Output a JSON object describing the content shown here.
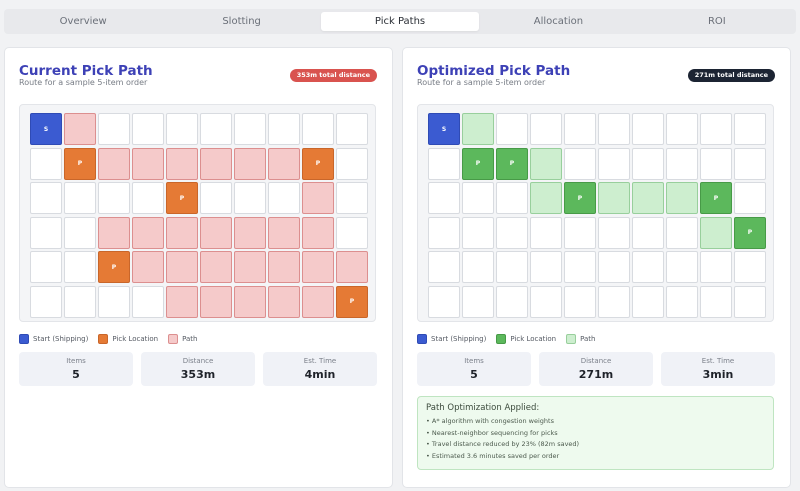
{
  "tabs": [
    "Overview",
    "Slotting",
    "Pick Paths",
    "Allocation",
    "ROI"
  ],
  "active_tab": "Pick Paths",
  "current": {
    "title": "Current Pick Path",
    "subtitle": "Route for a sample 5-item order",
    "badge": "353m total distance",
    "grid": [
      [
        "S",
        "R",
        "E",
        "E",
        "E",
        "E",
        "E",
        "E",
        "E",
        "E"
      ],
      [
        "E",
        "P",
        "R",
        "R",
        "R",
        "R",
        "R",
        "R",
        "P",
        "E"
      ],
      [
        "E",
        "E",
        "E",
        "E",
        "P",
        "E",
        "E",
        "E",
        "R",
        "E"
      ],
      [
        "E",
        "E",
        "R",
        "R",
        "R",
        "R",
        "R",
        "R",
        "R",
        "E"
      ],
      [
        "E",
        "E",
        "P",
        "R",
        "R",
        "R",
        "R",
        "R",
        "R",
        "R"
      ],
      [
        "E",
        "E",
        "E",
        "E",
        "R",
        "R",
        "R",
        "R",
        "R",
        "P"
      ]
    ],
    "legend": {
      "start": "Start (Shipping)",
      "pick": "Pick Location",
      "path": "Path"
    },
    "stats": [
      {
        "label": "Items",
        "value": "5"
      },
      {
        "label": "Distance",
        "value": "353m"
      },
      {
        "label": "Est. Time",
        "value": "4min"
      }
    ]
  },
  "optimized": {
    "title": "Optimized Pick Path",
    "subtitle": "Route for a sample 5-item order",
    "badge": "271m total distance",
    "grid": [
      [
        "S",
        "G",
        "E",
        "E",
        "E",
        "E",
        "E",
        "E",
        "E",
        "E"
      ],
      [
        "E",
        "P",
        "P",
        "G",
        "E",
        "E",
        "E",
        "E",
        "E",
        "E"
      ],
      [
        "E",
        "E",
        "E",
        "G",
        "P",
        "G",
        "G",
        "G",
        "P",
        "E"
      ],
      [
        "E",
        "E",
        "E",
        "E",
        "E",
        "E",
        "E",
        "E",
        "G",
        "P"
      ],
      [
        "E",
        "E",
        "E",
        "E",
        "E",
        "E",
        "E",
        "E",
        "E",
        "E"
      ],
      [
        "E",
        "E",
        "E",
        "E",
        "E",
        "E",
        "E",
        "E",
        "E",
        "E"
      ]
    ],
    "legend": {
      "start": "Start (Shipping)",
      "pick": "Pick Location",
      "path": "Path"
    },
    "stats": [
      {
        "label": "Items",
        "value": "5"
      },
      {
        "label": "Distance",
        "value": "271m"
      },
      {
        "label": "Est. Time",
        "value": "3min"
      }
    ],
    "optimization": {
      "title": "Path Optimization Applied:",
      "items": [
        "A* algorithm with congestion weights",
        "Nearest-neighbor sequencing for picks",
        "Travel distance reduced by 23% (82m saved)",
        "Estimated 3.6 minutes saved per order"
      ]
    }
  },
  "cell_labels": {
    "start": "S",
    "pick": "P"
  },
  "colors": {
    "accent": "#3d41b6",
    "start": "#3b5bd1",
    "pick_current": "#e57a35",
    "path_current": "#f5caca",
    "pick_optimized": "#5cb85c",
    "path_optimized": "#cdeecf",
    "badge_current": "#d9534f",
    "badge_optimized": "#1c2433"
  }
}
